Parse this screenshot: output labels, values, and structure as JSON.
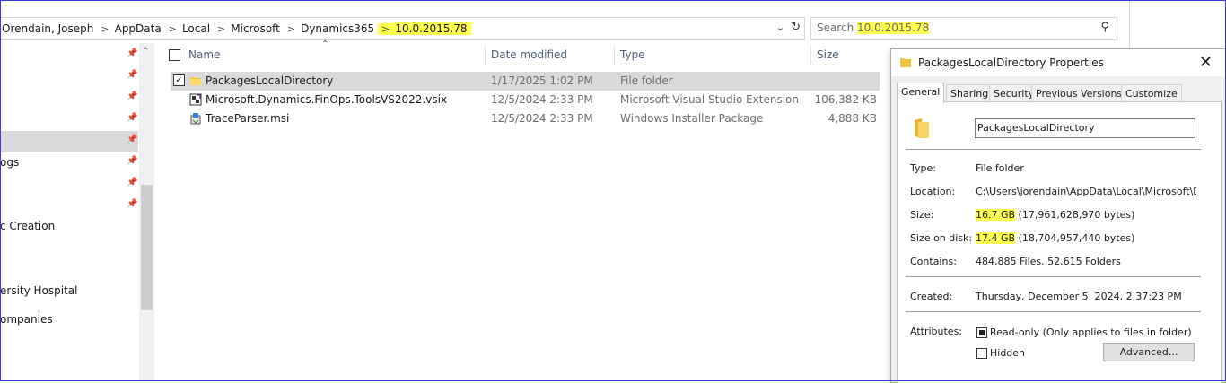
{
  "breadcrumb": {
    "items": [
      "Orendain, Joseph",
      "AppData",
      "Local",
      "Microsoft",
      "Dynamics365",
      "10.0.2015.78"
    ],
    "separator": ">"
  },
  "search": {
    "placeholder": "Search 10.0.2015.78"
  },
  "nav": {
    "items": [
      {
        "label": ""
      },
      {
        "label": ""
      },
      {
        "label": ""
      },
      {
        "label": ""
      },
      {
        "label": ""
      },
      {
        "label": "ogs"
      },
      {
        "label": ""
      },
      {
        "label": ""
      },
      {
        "label": "c Creation"
      },
      {
        "label": "ersity Hospital"
      },
      {
        "label": "ompanies"
      }
    ]
  },
  "file_list": {
    "columns": {
      "name": "Name",
      "date": "Date modified",
      "type": "Type",
      "size": "Size"
    },
    "rows": [
      {
        "name": "PackagesLocalDirectory",
        "date": "1/17/2025 1:02 PM",
        "type": "File folder",
        "size": "",
        "icon": "folder-icon",
        "selected": true
      },
      {
        "name": "Microsoft.Dynamics.FinOps.ToolsVS2022.vsix",
        "date": "12/5/2024 2:33 PM",
        "type": "Microsoft Visual Studio Extension",
        "size": "106,382 KB",
        "icon": "vsix-icon",
        "selected": false
      },
      {
        "name": "TraceParser.msi",
        "date": "12/5/2024 2:33 PM",
        "type": "Windows Installer Package",
        "size": "4,888 KB",
        "icon": "msi-icon",
        "selected": false
      }
    ]
  },
  "properties": {
    "title": "PackagesLocalDirectory Properties",
    "tabs": [
      "General",
      "Sharing",
      "Security",
      "Previous Versions",
      "Customize"
    ],
    "name_value": "PackagesLocalDirectory",
    "fields": {
      "type_label": "Type:",
      "type_value": "File folder",
      "location_label": "Location:",
      "location_value": "C:\\Users\\jorendain\\AppData\\Local\\Microsoft\\Dyna",
      "size_label": "Size:",
      "size_value_hl": "16.7 GB",
      "size_value_rest": " (17,961,628,970 bytes)",
      "disk_label": "Size on disk:",
      "disk_value_hl": "17.4 GB",
      "disk_value_rest": " (18,704,957,440 bytes)",
      "contains_label": "Contains:",
      "contains_value": "484,885 Files, 52,615 Folders",
      "created_label": "Created:",
      "created_value": "Thursday, December 5, 2024, 2:37:23 PM",
      "attributes_label": "Attributes:",
      "readonly_label": "Read-only (Only applies to files in folder)",
      "hidden_label": "Hidden",
      "advanced_label": "Advanced..."
    }
  },
  "colors": {
    "highlight": "#ffff4d",
    "selection": "#d9d9d9",
    "folder": "#f4c542"
  }
}
